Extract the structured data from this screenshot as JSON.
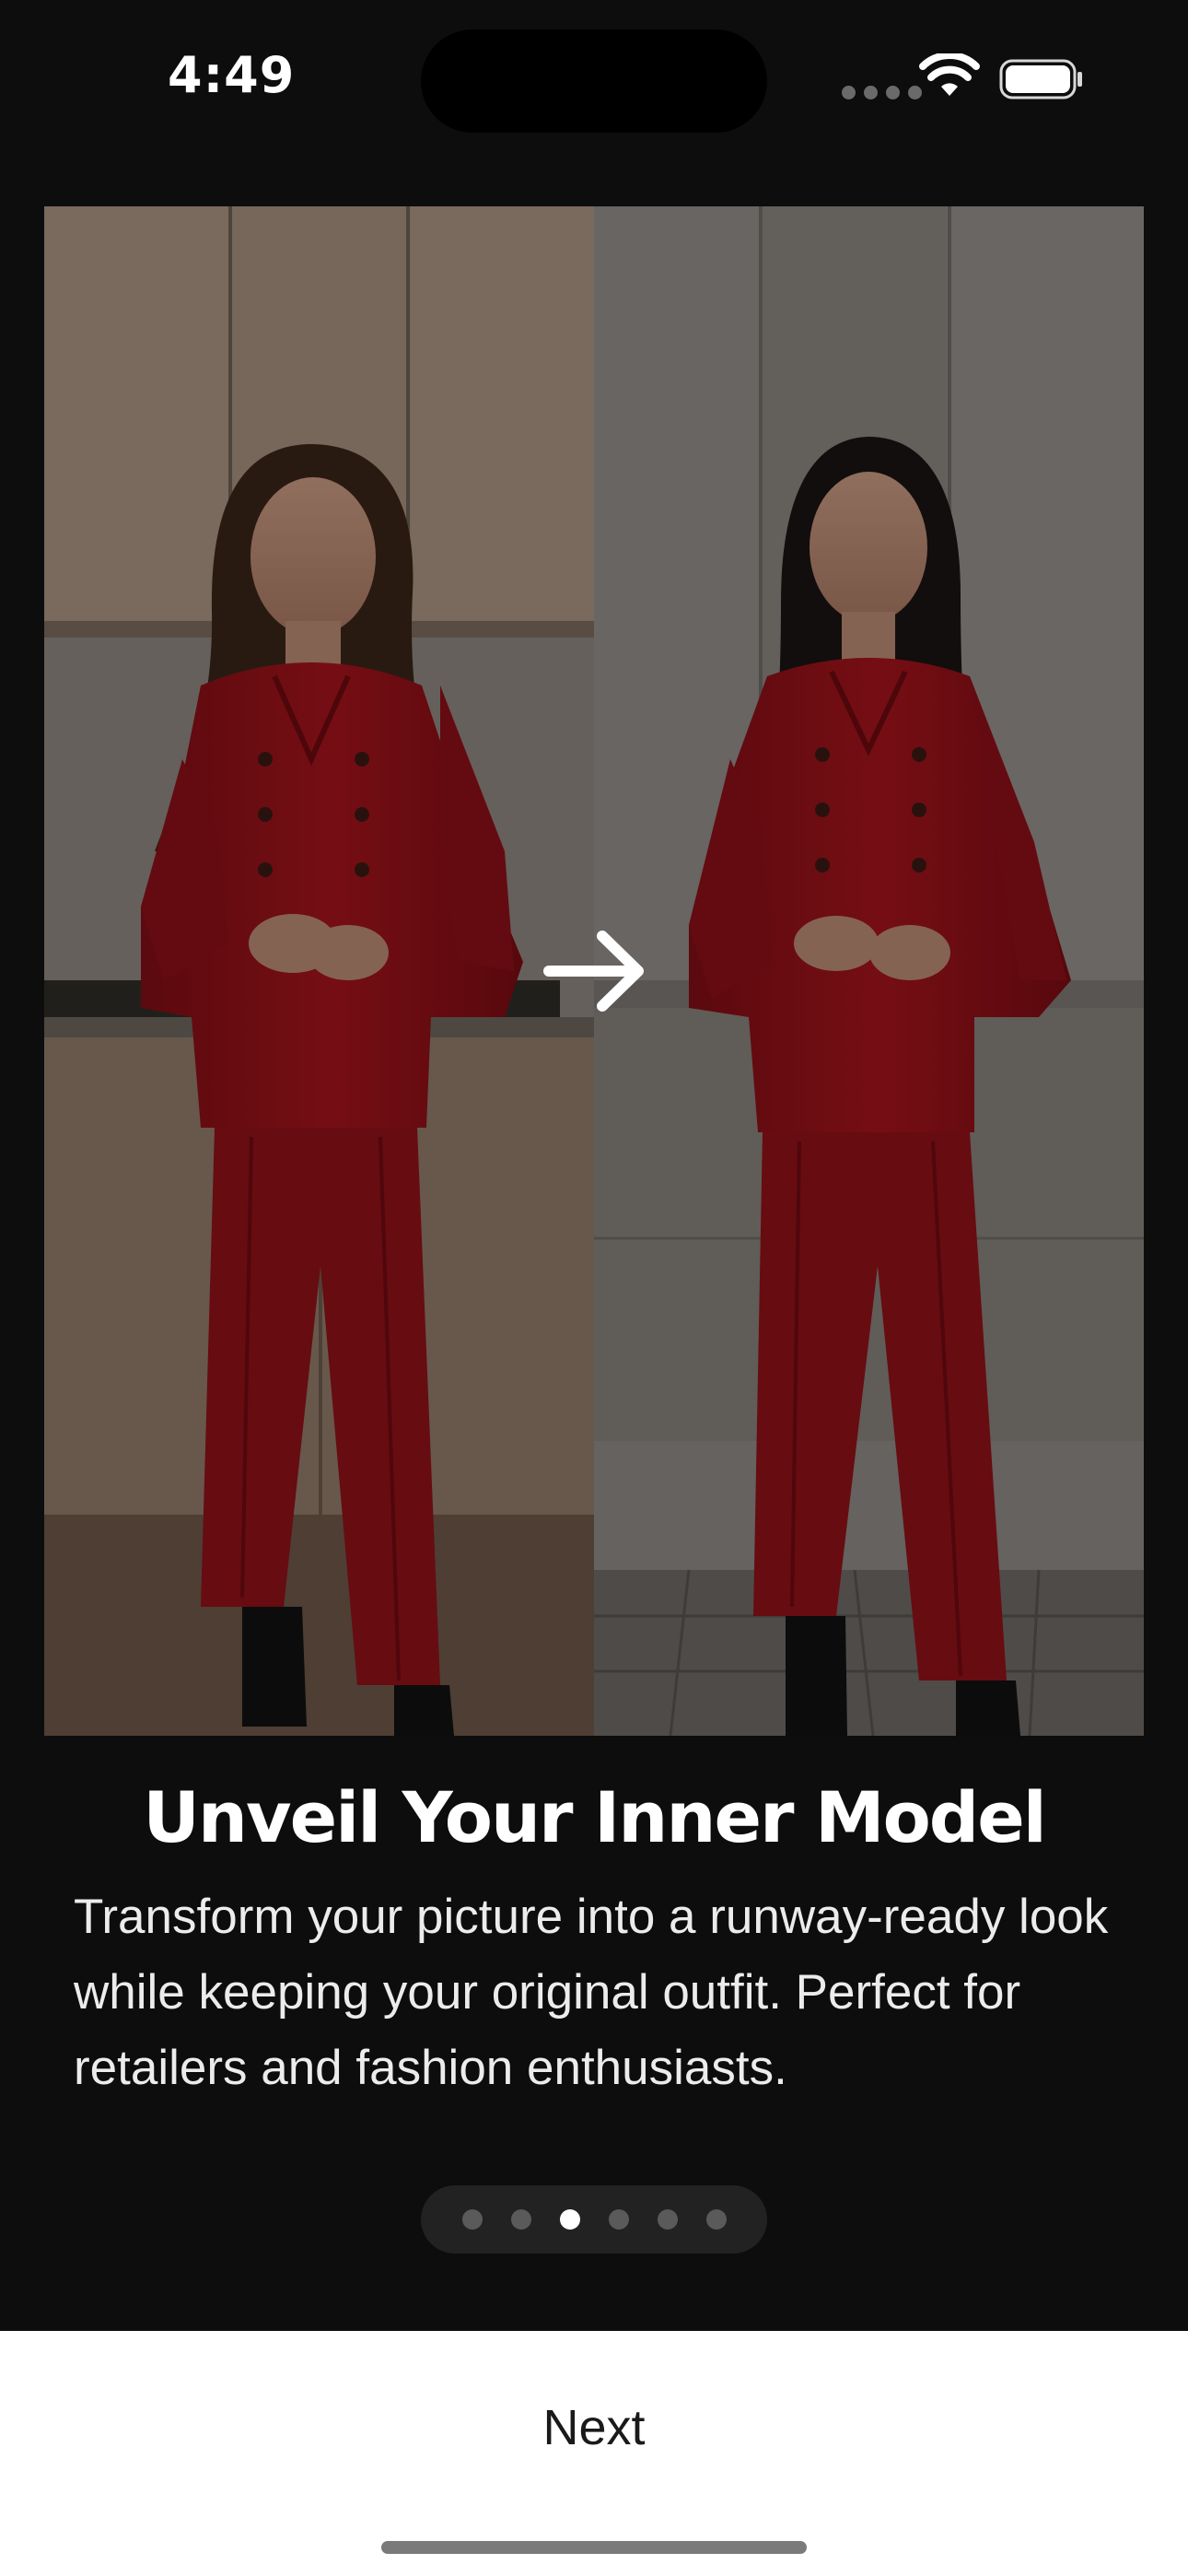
{
  "status_bar": {
    "time": "4:49",
    "icons": [
      "cellular-signal-icon",
      "wifi-icon",
      "battery-icon"
    ]
  },
  "hero": {
    "left_image": "woman-red-suit-kitchen",
    "right_image": "model-red-suit-outdoor",
    "divider_icon": "arrow-right-icon"
  },
  "onboarding": {
    "title": "Unveil Your Inner Model",
    "description": "Transform your picture into a runway-ready look while keeping your original outfit. Perfect for retailers and fashion enthusiasts."
  },
  "pagination": {
    "total_pages": 6,
    "current_page": 3
  },
  "footer": {
    "next_label": "Next"
  },
  "colors": {
    "background": "#0d0d0d",
    "sheet": "#ffffff",
    "outfit_red": "#a3141c",
    "dot_inactive": "#5a5a5a",
    "dot_active": "#ffffff"
  }
}
